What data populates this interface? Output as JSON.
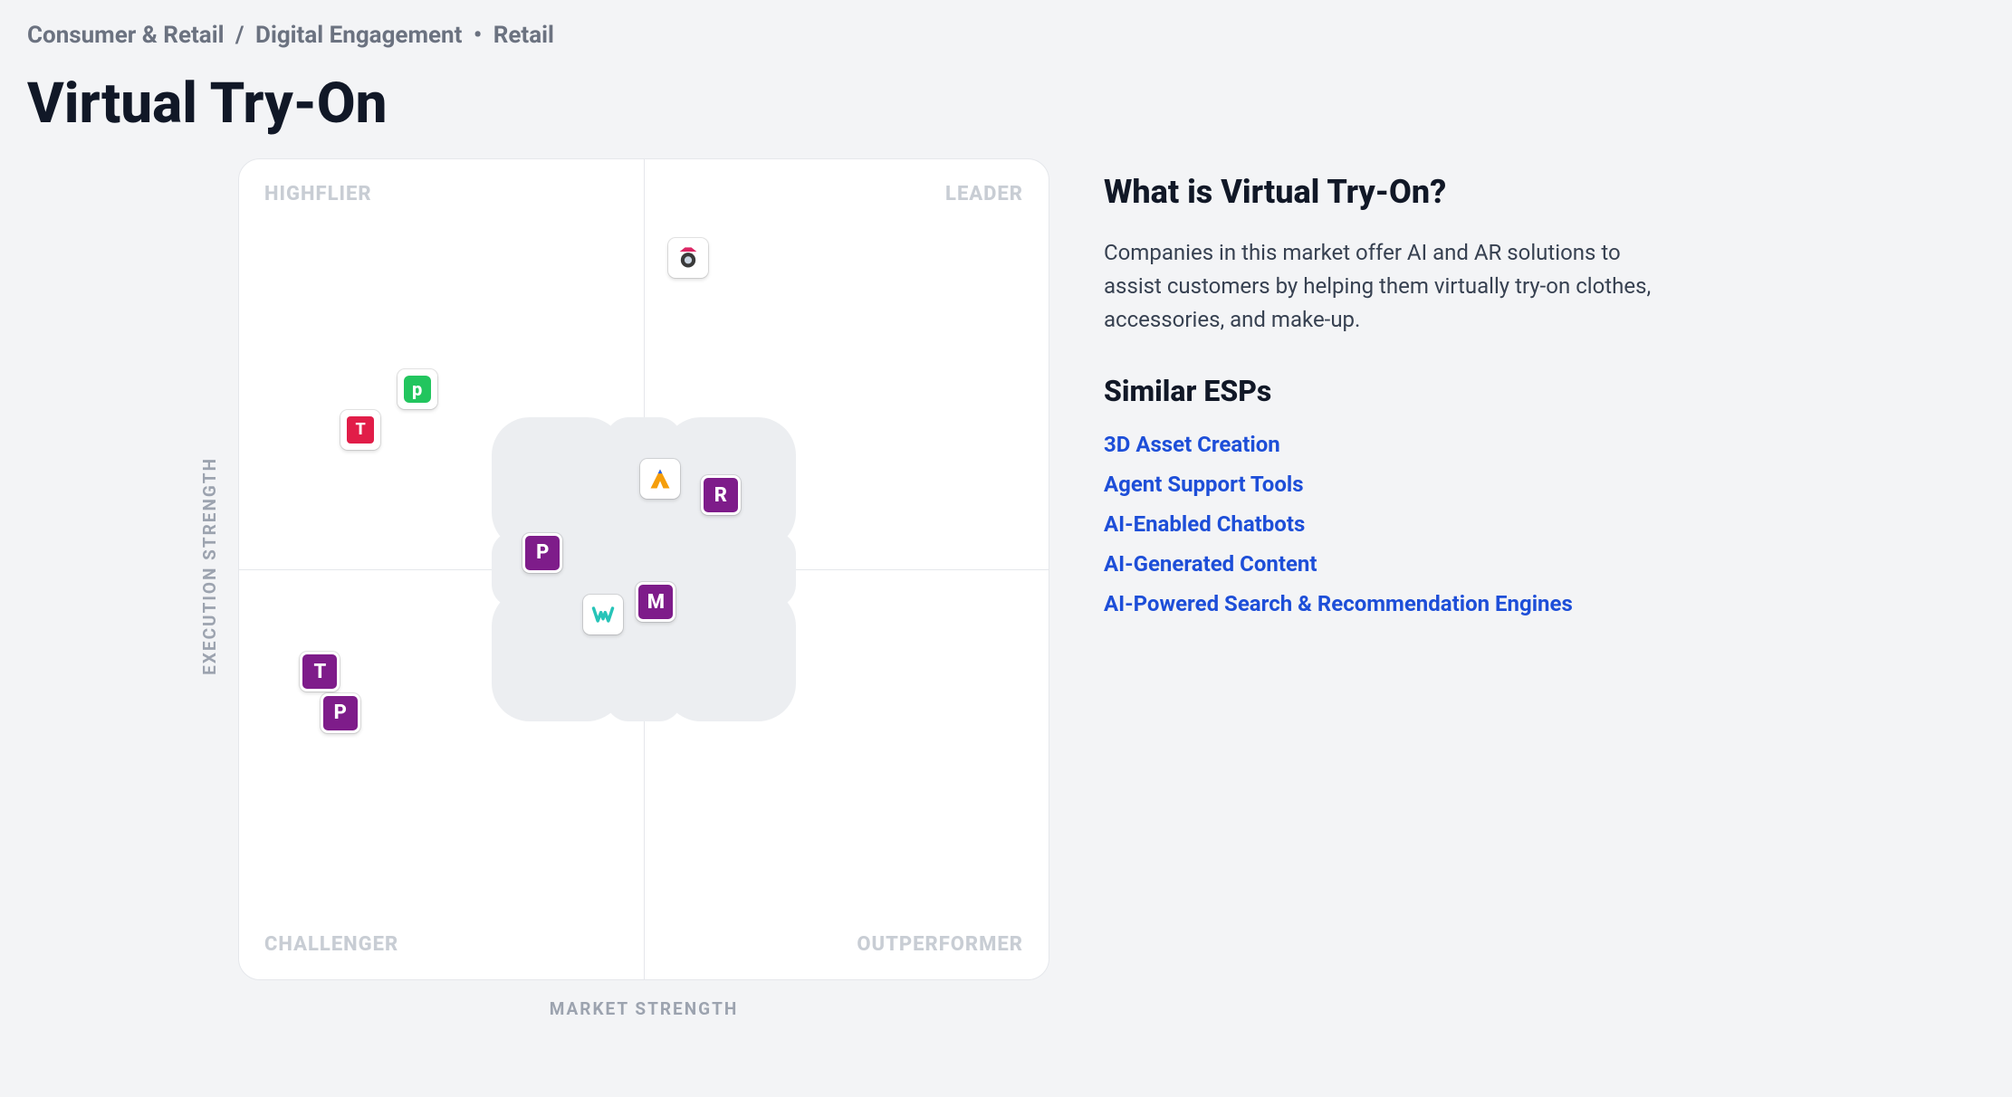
{
  "breadcrumb": {
    "category": "Consumer & Retail",
    "subcategory": "Digital Engagement",
    "tag": "Retail",
    "slash": " / ",
    "dot": " • "
  },
  "title": "Virtual Try-On",
  "axes": {
    "x": "MARKET STRENGTH",
    "y": "EXECUTION STRENGTH"
  },
  "quadrants": {
    "tl": "HIGHFLIER",
    "tr": "LEADER",
    "bl": "CHALLENGER",
    "br": "OUTPERFORMER"
  },
  "sidebar": {
    "about_heading": "What is Virtual Try-On?",
    "about_body": "Companies in this market offer AI and AR solutions to assist customers by helping them virtually try-on clothes, accessories, and make-up.",
    "similar_heading": "Similar ESPs",
    "similar": [
      "3D Asset Creation",
      "Agent Support Tools",
      "AI-Enabled Chatbots",
      "AI-Generated Content",
      "AI-Powered Search & Recommendation Engines"
    ]
  },
  "chart_data": {
    "type": "scatter",
    "xlabel": "MARKET STRENGTH",
    "ylabel": "EXECUTION STRENGTH",
    "xlim": [
      0,
      100
    ],
    "ylim": [
      0,
      100
    ],
    "quadrant_labels": {
      "top_left": "HIGHFLIER",
      "top_right": "LEADER",
      "bottom_left": "CHALLENGER",
      "bottom_right": "OUTPERFORMER"
    },
    "series": [
      {
        "name": "company-1-camera-logo",
        "label": "",
        "x": 55.5,
        "y": 88.0,
        "color": "#dc2664",
        "style": "image"
      },
      {
        "name": "company-p-green",
        "label": "p",
        "x": 22.0,
        "y": 72.0,
        "color": "#22c55e",
        "style": "white-bg-green-box"
      },
      {
        "name": "company-t-red",
        "label": "T",
        "x": 15.0,
        "y": 67.0,
        "color": "#e11d48",
        "style": "white-bg-red-box"
      },
      {
        "name": "company-a-logo",
        "label": "A",
        "x": 52.0,
        "y": 61.0,
        "color": "#f59e0b",
        "style": "image"
      },
      {
        "name": "company-r",
        "label": "R",
        "x": 59.5,
        "y": 59.0,
        "color": "#7e1c8a",
        "style": "letter"
      },
      {
        "name": "company-p1",
        "label": "P",
        "x": 37.5,
        "y": 52.0,
        "color": "#7e1c8a",
        "style": "letter"
      },
      {
        "name": "company-w-logo",
        "label": "W",
        "x": 45.0,
        "y": 44.5,
        "color": "#27c4b8",
        "style": "image"
      },
      {
        "name": "company-m",
        "label": "M",
        "x": 51.5,
        "y": 46.0,
        "color": "#7e1c8a",
        "style": "letter"
      },
      {
        "name": "company-t2",
        "label": "T",
        "x": 10.0,
        "y": 37.5,
        "color": "#7e1c8a",
        "style": "letter"
      },
      {
        "name": "company-p2",
        "label": "P",
        "x": 12.5,
        "y": 32.5,
        "color": "#7e1c8a",
        "style": "letter"
      }
    ]
  }
}
